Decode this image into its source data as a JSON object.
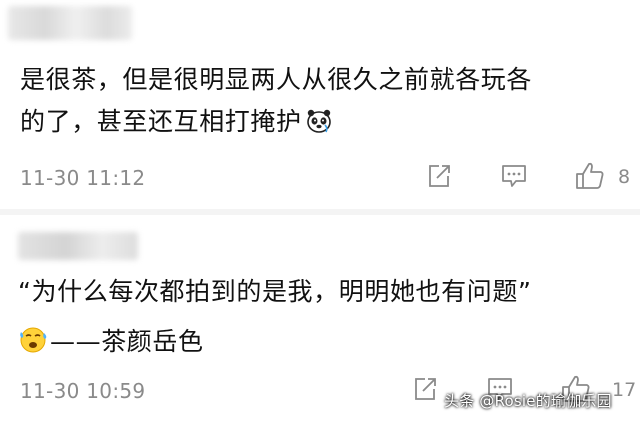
{
  "comments": [
    {
      "line1": "是很茶，但是很明显两人从很久之前就各玩各",
      "line2": "的了，甚至还互相打掩护",
      "emoji": "panda-face-icon",
      "time": "11-30 11:12",
      "likes": "8"
    },
    {
      "line1": "“为什么每次都拍到的是我，明明她也有问题”",
      "line2": "——茶颜岳色",
      "emoji": "sweating-face-icon",
      "time": "11-30 10:59",
      "likes": "17"
    }
  ],
  "watermark": "头条 @Rosie的瑜伽乐园",
  "colors": {
    "text": "#111111",
    "meta": "#8a8a8a",
    "divider": "#f4f4f4",
    "icon_stroke": "#8a8a8a"
  }
}
